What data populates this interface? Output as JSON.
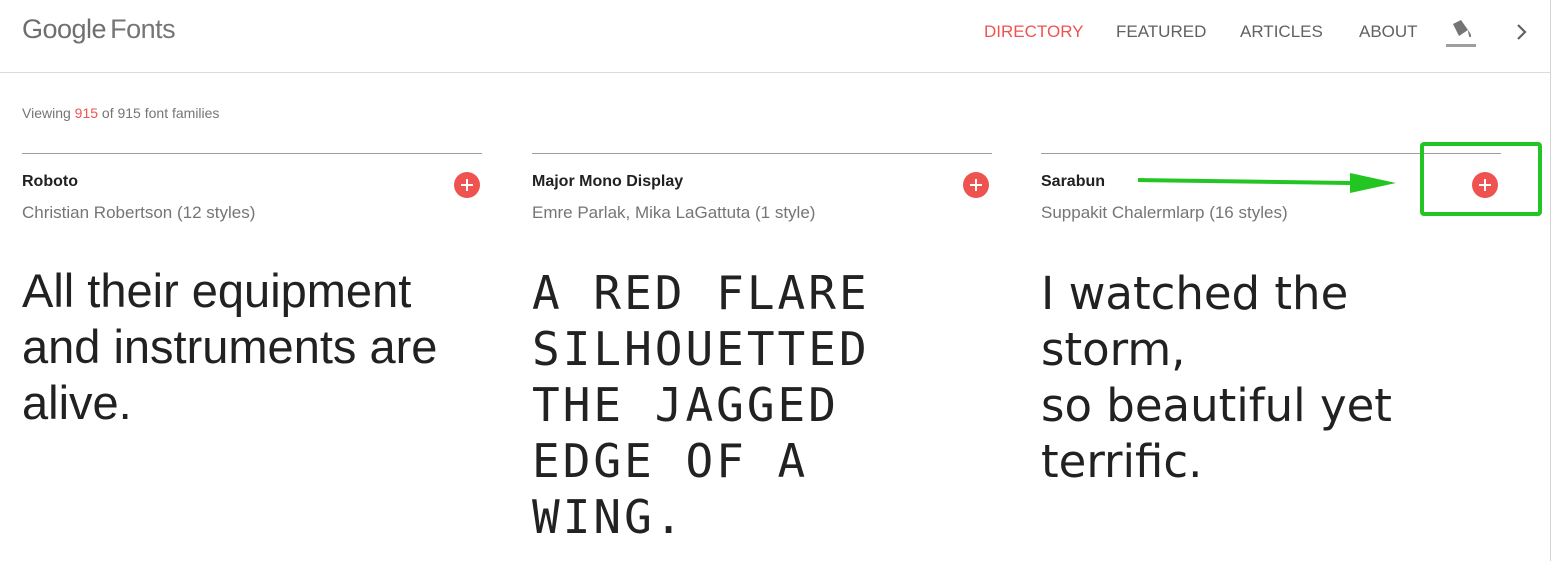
{
  "header": {
    "logo_brand": "Google",
    "logo_product": "Fonts",
    "nav": [
      {
        "label": "DIRECTORY",
        "active": true
      },
      {
        "label": "FEATURED",
        "active": false
      },
      {
        "label": "ARTICLES",
        "active": false
      },
      {
        "label": "ABOUT",
        "active": false
      }
    ],
    "icons": [
      "paint-bucket-icon",
      "chevron-right-icon"
    ]
  },
  "summary": {
    "prefix": "Viewing",
    "shown": "915",
    "suffix": "of 915 font families"
  },
  "fonts": [
    {
      "family": "Roboto",
      "designer": "Christian Robertson (12 styles)",
      "sample": "All their equipment\nand instruments are\nalive."
    },
    {
      "family": "Major Mono Display",
      "designer": "Emre Parlak, Mika LaGattuta (1 style)",
      "sample": "A RED FLARE\nSILHOUETTED\nTHE JAGGED\nEDGE OF A\nWING."
    },
    {
      "family": "Sarabun",
      "designer": "Suppakit Chalermlarp (16 styles)",
      "sample": "I watched the storm,\nso beautiful yet\nterrific."
    }
  ],
  "colors": {
    "accent": "#ef5350",
    "annotation": "#22c522",
    "text_primary": "#212121",
    "text_secondary": "#757575"
  }
}
